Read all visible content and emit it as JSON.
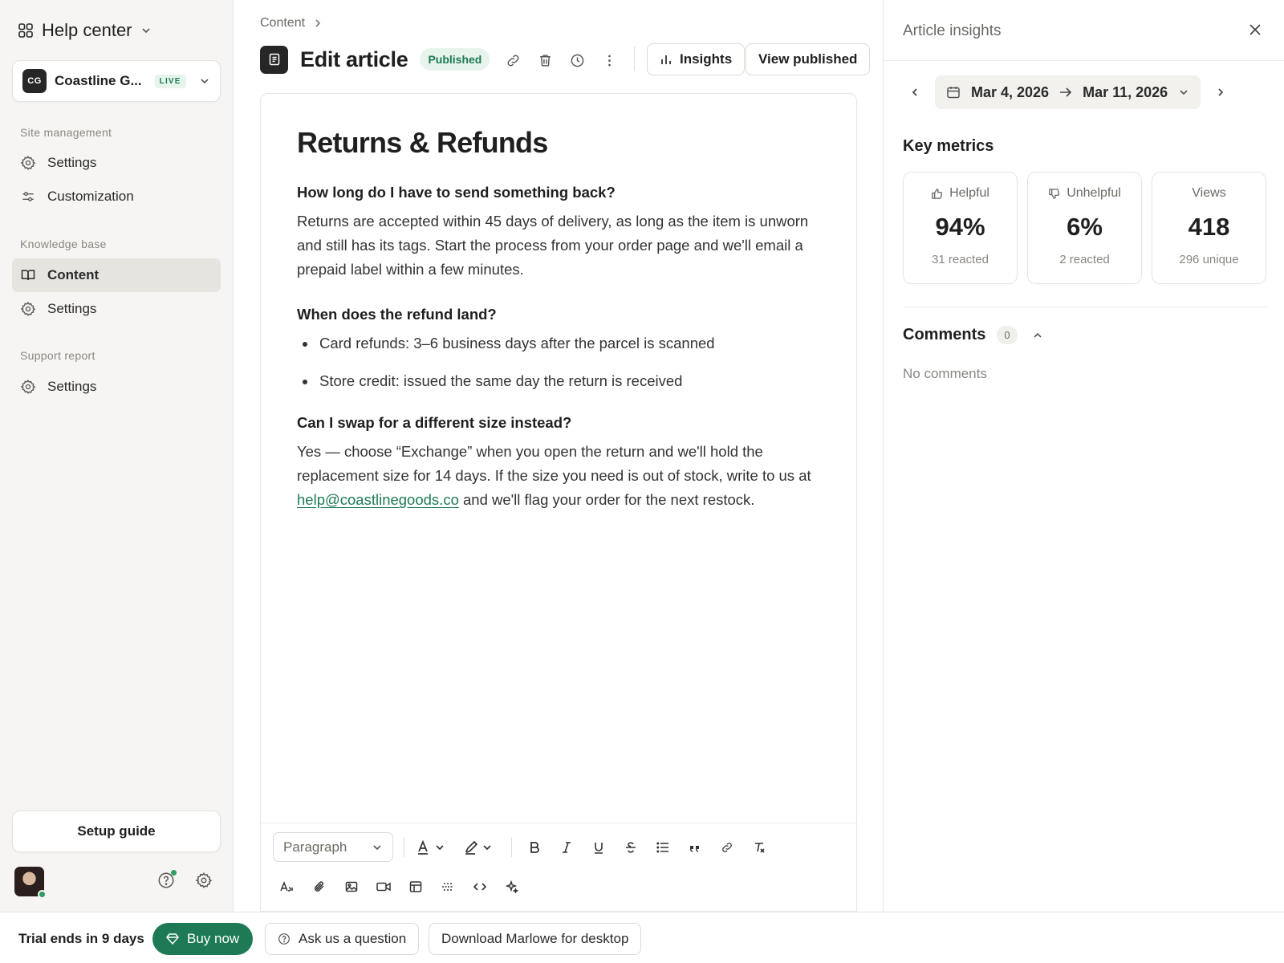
{
  "sidebar": {
    "app_title": "Help center",
    "workspace": {
      "initials": "CG",
      "name": "Coastline G...",
      "status": "LIVE"
    },
    "sections": [
      {
        "label": "Site management",
        "items": [
          {
            "label": "Settings",
            "icon": "gear-icon"
          },
          {
            "label": "Customization",
            "icon": "sliders-icon"
          }
        ]
      },
      {
        "label": "Knowledge base",
        "items": [
          {
            "label": "Content",
            "icon": "book-icon",
            "active": true
          },
          {
            "label": "Settings",
            "icon": "gear-icon"
          }
        ]
      },
      {
        "label": "Support report",
        "items": [
          {
            "label": "Settings",
            "icon": "gear-icon"
          }
        ]
      }
    ],
    "setup_guide": "Setup guide"
  },
  "main": {
    "breadcrumb": "Content",
    "title": "Edit article",
    "status": "Published",
    "insights_btn": "Insights",
    "view_published_btn": "View published"
  },
  "article": {
    "title": "Returns & Refunds",
    "q1": "How long do I have to send something back?",
    "a1": "Returns are accepted within 45 days of delivery, as long as the item is unworn and still has its tags. Start the process from your order page and we'll email a prepaid label within a few minutes.",
    "q2": "When does the refund land?",
    "bullets": [
      "Card refunds: 3–6 business days after the parcel is scanned",
      "Store credit: issued the same day the return is received"
    ],
    "q3": "Can I swap for a different size instead?",
    "a3_before": "Yes — choose “Exchange” when you open the return and we'll hold the replacement size for 14 days. If the size you need is out of stock, write to us at ",
    "a3_link": "help@coastlinegoods.co",
    "a3_after": " and we'll flag your order for the next restock."
  },
  "editor_toolbar": {
    "block_type": "Paragraph"
  },
  "insights": {
    "title": "Article insights",
    "date_from": "Mar 4, 2026",
    "date_to": "Mar 11, 2026",
    "key_metrics_title": "Key metrics",
    "metrics": [
      {
        "label": "Helpful",
        "value": "94%",
        "sub": "31 reacted"
      },
      {
        "label": "Unhelpful",
        "value": "6%",
        "sub": "2 reacted"
      },
      {
        "label": "Views",
        "value": "418",
        "sub": "296 unique"
      }
    ],
    "comments_title": "Comments",
    "comments_count": "0",
    "no_comments": "No comments"
  },
  "bottom_bar": {
    "trial_text": "Trial ends in 9 days",
    "buy_now": "Buy now",
    "ask_question": "Ask us a question",
    "download": "Download Marlowe for desktop"
  },
  "colors": {
    "accent_green": "#1d7a55",
    "sidebar_bg": "#f6f5f3",
    "active_item_bg": "#e6e4df"
  }
}
